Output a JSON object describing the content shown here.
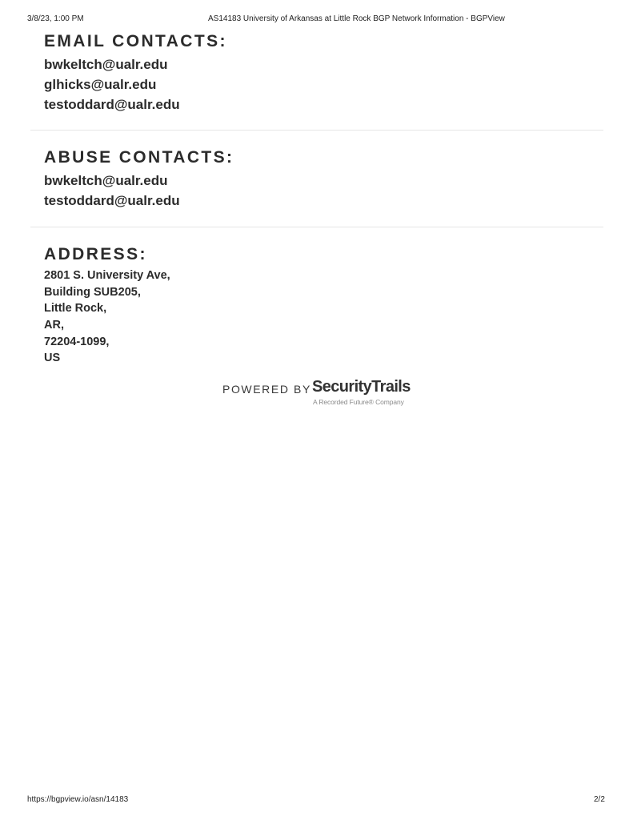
{
  "print_header": {
    "date": "3/8/23, 1:00 PM",
    "title": "AS14183 University of Arkansas at Little Rock BGP Network Information - BGPView"
  },
  "email_contacts": {
    "heading": "EMAIL CONTACTS:",
    "items": [
      "bwkeltch@ualr.edu",
      "glhicks@ualr.edu",
      "testoddard@ualr.edu"
    ]
  },
  "abuse_contacts": {
    "heading": "ABUSE CONTACTS:",
    "items": [
      "bwkeltch@ualr.edu",
      "testoddard@ualr.edu"
    ]
  },
  "address": {
    "heading": "ADDRESS:",
    "lines": [
      "2801 S. University Ave,",
      "Building SUB205,",
      "Little Rock,",
      "AR,",
      "72204-1099,",
      "US"
    ]
  },
  "powered_by": {
    "prefix": "POWERED BY",
    "brand": "SecurityTrails",
    "tagline": "A Recorded Future® Company"
  },
  "print_footer": {
    "url": "https://bgpview.io/asn/14183",
    "page": "2/2"
  }
}
